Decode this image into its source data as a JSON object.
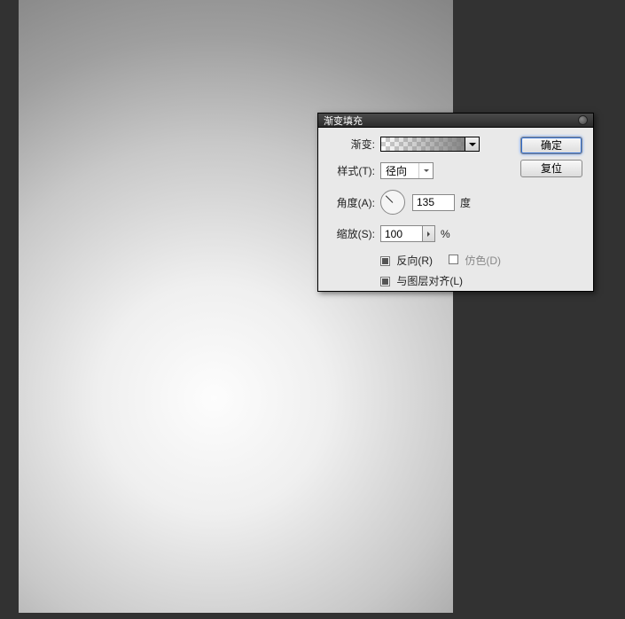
{
  "dialog": {
    "title": "渐变填充",
    "buttons": {
      "ok": "确定",
      "reset": "复位"
    },
    "gradient": {
      "label": "渐变:"
    },
    "style": {
      "label": "样式(T):",
      "value": "径向"
    },
    "angle": {
      "label": "角度(A):",
      "value": "135",
      "unit": "度"
    },
    "scale": {
      "label": "缩放(S):",
      "value": "100",
      "unit": "%"
    },
    "checks": {
      "reverse": {
        "label": "反向(R)",
        "checked": true
      },
      "dither": {
        "label": "仿色(D)",
        "checked": false
      },
      "align": {
        "label": "与图层对齐(L)",
        "checked": true
      }
    }
  }
}
